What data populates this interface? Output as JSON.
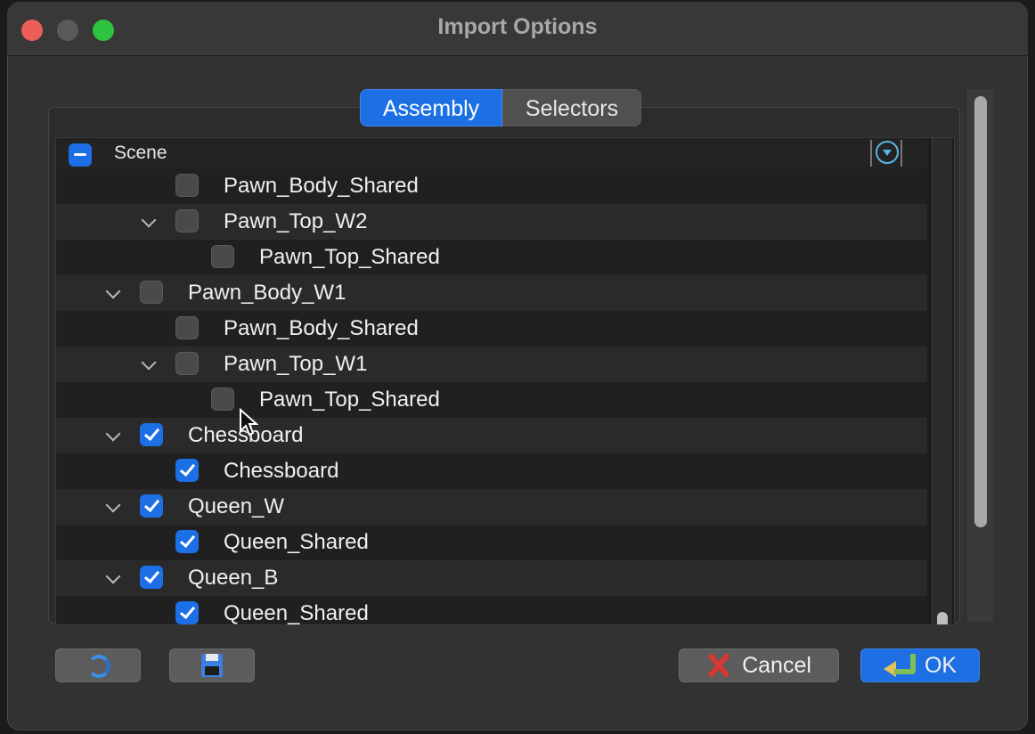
{
  "window": {
    "title": "Import Options"
  },
  "tabs": [
    {
      "label": "Assembly",
      "active": true
    },
    {
      "label": "Selectors",
      "active": false
    }
  ],
  "tree": {
    "header": {
      "label": "Scene",
      "state": "mixed"
    },
    "rows": [
      {
        "label": "Pawn_Body_Shared",
        "level": 2,
        "expandable": false,
        "checked": false
      },
      {
        "label": "Pawn_Top_W2",
        "level": 2,
        "expandable": true,
        "checked": false
      },
      {
        "label": "Pawn_Top_Shared",
        "level": 3,
        "expandable": false,
        "checked": false
      },
      {
        "label": "Pawn_Body_W1",
        "level": 1,
        "expandable": true,
        "checked": false
      },
      {
        "label": "Pawn_Body_Shared",
        "level": 2,
        "expandable": false,
        "checked": false
      },
      {
        "label": "Pawn_Top_W1",
        "level": 2,
        "expandable": true,
        "checked": false
      },
      {
        "label": "Pawn_Top_Shared",
        "level": 3,
        "expandable": false,
        "checked": false
      },
      {
        "label": "Chessboard",
        "level": 1,
        "expandable": true,
        "checked": true
      },
      {
        "label": "Chessboard",
        "level": 2,
        "expandable": false,
        "checked": true
      },
      {
        "label": "Queen_W",
        "level": 1,
        "expandable": true,
        "checked": true
      },
      {
        "label": "Queen_Shared",
        "level": 2,
        "expandable": false,
        "checked": true
      },
      {
        "label": "Queen_B",
        "level": 1,
        "expandable": true,
        "checked": true
      },
      {
        "label": "Queen_Shared",
        "level": 2,
        "expandable": false,
        "checked": true
      }
    ]
  },
  "buttons": {
    "refresh_icon": "refresh-icon",
    "save_icon": "floppy-disk-icon",
    "cancel_label": "Cancel",
    "ok_label": "OK"
  },
  "colors": {
    "accent": "#1d6fe3",
    "close": "#ed5f56",
    "maximize": "#2dc23f"
  }
}
